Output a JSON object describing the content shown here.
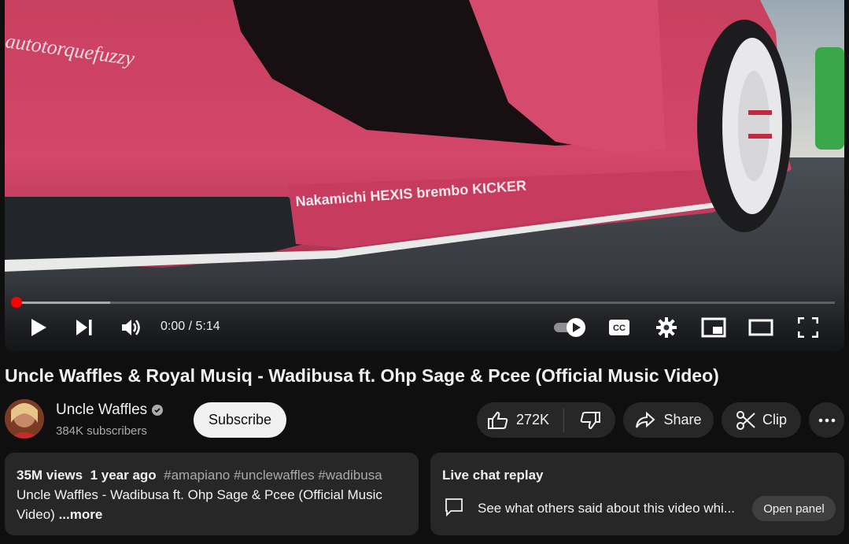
{
  "player": {
    "time_display": "0:00 / 5:14",
    "progress": 0,
    "buffered": 0.115,
    "video_side_decal": "autotorquefuzzy",
    "video_sponsor_text": "Nakamichi  HEXIS  brembo  KICKER",
    "controls": [
      "play-icon",
      "next-icon",
      "volume-icon",
      "autoplay-toggle",
      "captions-icon",
      "settings-icon",
      "miniplayer-icon",
      "theater-icon",
      "fullscreen-icon"
    ],
    "accent_color": "#ff0000"
  },
  "video": {
    "title": "Uncle Waffles & Royal Musiq - Wadibusa ft. Ohp Sage & Pcee (Official Music Video)"
  },
  "channel": {
    "name": "Uncle Waffles",
    "subscribers": "384K subscribers",
    "subscribe_label": "Subscribe"
  },
  "actions": {
    "like_count": "272K",
    "share_label": "Share",
    "clip_label": "Clip"
  },
  "description": {
    "views": "35M views",
    "age": "1 year ago",
    "hashtags": "#amapiano #unclewaffles #wadibusa",
    "line1": "Uncle Waffles - Wadibusa ft. Ohp Sage & Pcee (Official Music",
    "line2": "Video)",
    "more_label": "...more"
  },
  "live_chat": {
    "title": "Live chat replay",
    "prompt": "See what others said about this video whi...",
    "open_panel_label": "Open panel"
  }
}
